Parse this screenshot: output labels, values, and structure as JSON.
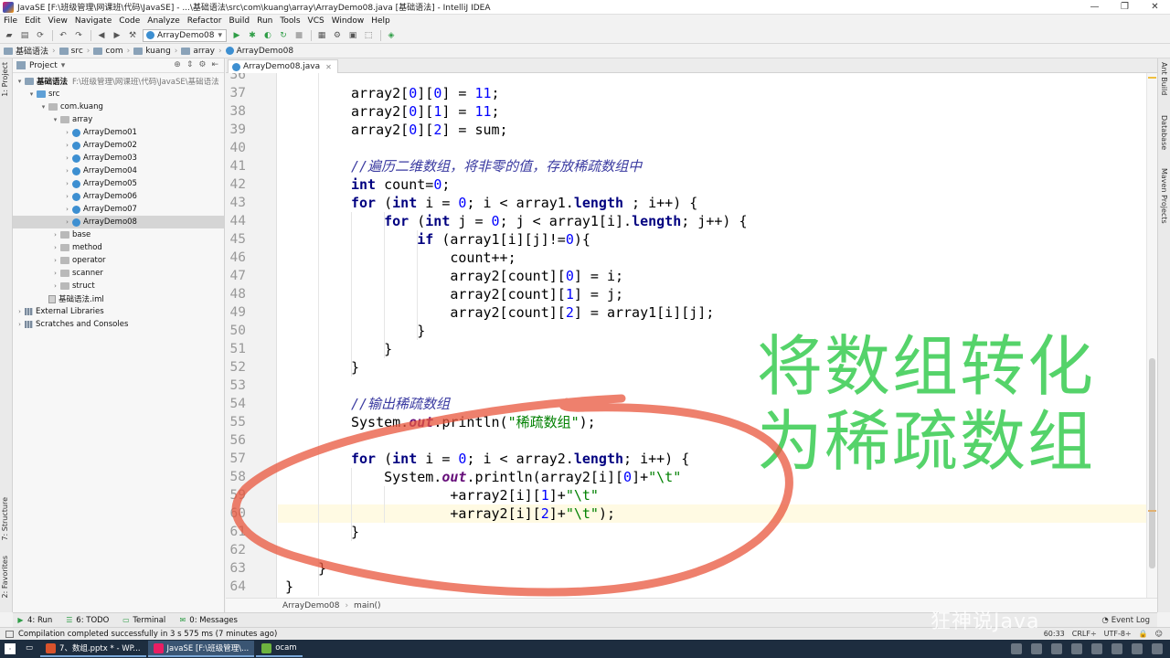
{
  "window": {
    "title": "JavaSE [F:\\班级管理\\网课班\\代码\\JavaSE] - ...\\基础语法\\src\\com\\kuang\\array\\ArrayDemo08.java [基础语法] - IntelliJ IDEA",
    "controls": [
      "—",
      "❐",
      "✕"
    ]
  },
  "menu": [
    "File",
    "Edit",
    "View",
    "Navigate",
    "Code",
    "Analyze",
    "Refactor",
    "Build",
    "Run",
    "Tools",
    "VCS",
    "Window",
    "Help"
  ],
  "toolbar": {
    "run_config": "ArrayDemo08"
  },
  "breadcrumb": [
    "基础语法",
    "src",
    "com",
    "kuang",
    "array",
    "ArrayDemo08"
  ],
  "left_tabs": [
    "1: Project",
    "7: Structure",
    "2: Favorites"
  ],
  "right_tabs": [
    "Ant Build",
    "Database",
    "Maven Projects"
  ],
  "project": {
    "header": "Project",
    "tree": [
      {
        "label": "基础语法",
        "path": "F:\\班级管理\\网课班\\代码\\JavaSE\\基础语法",
        "type": "module"
      },
      {
        "label": "src",
        "type": "src"
      },
      {
        "label": "com.kuang",
        "type": "pkg"
      },
      {
        "label": "array",
        "type": "pkg"
      },
      {
        "label": "ArrayDemo01",
        "type": "class"
      },
      {
        "label": "ArrayDemo02",
        "type": "class"
      },
      {
        "label": "ArrayDemo03",
        "type": "class"
      },
      {
        "label": "ArrayDemo04",
        "type": "class"
      },
      {
        "label": "ArrayDemo05",
        "type": "class"
      },
      {
        "label": "ArrayDemo06",
        "type": "class"
      },
      {
        "label": "ArrayDemo07",
        "type": "class"
      },
      {
        "label": "ArrayDemo08",
        "type": "class"
      },
      {
        "label": "base",
        "type": "pkg"
      },
      {
        "label": "method",
        "type": "pkg"
      },
      {
        "label": "operator",
        "type": "pkg"
      },
      {
        "label": "scanner",
        "type": "pkg"
      },
      {
        "label": "struct",
        "type": "pkg"
      },
      {
        "label": "基础语法.iml",
        "type": "file"
      },
      {
        "label": "External Libraries",
        "type": "lib"
      },
      {
        "label": "Scratches and Consoles",
        "type": "lib"
      }
    ]
  },
  "editor": {
    "tab": "ArrayDemo08.java",
    "line_numbers": [
      "36",
      "37",
      "38",
      "39",
      "40",
      "41",
      "42",
      "43",
      "44",
      "45",
      "46",
      "47",
      "48",
      "49",
      "50",
      "51",
      "52",
      "53",
      "54",
      "55",
      "56",
      "57",
      "58",
      "59",
      "60",
      "61",
      "62",
      "63",
      "64"
    ],
    "code_lines": [
      [],
      [
        {
          "t": "array2[",
          "c": ""
        },
        {
          "t": "0",
          "c": "num"
        },
        {
          "t": "][",
          "c": ""
        },
        {
          "t": "0",
          "c": "num"
        },
        {
          "t": "] = ",
          "c": ""
        },
        {
          "t": "11",
          "c": "num"
        },
        {
          "t": ";",
          "c": ""
        }
      ],
      [
        {
          "t": "array2[",
          "c": ""
        },
        {
          "t": "0",
          "c": "num"
        },
        {
          "t": "][",
          "c": ""
        },
        {
          "t": "1",
          "c": "num"
        },
        {
          "t": "] = ",
          "c": ""
        },
        {
          "t": "11",
          "c": "num"
        },
        {
          "t": ";",
          "c": ""
        }
      ],
      [
        {
          "t": "array2[",
          "c": ""
        },
        {
          "t": "0",
          "c": "num"
        },
        {
          "t": "][",
          "c": ""
        },
        {
          "t": "2",
          "c": "num"
        },
        {
          "t": "] = sum;",
          "c": ""
        }
      ],
      [],
      [
        {
          "t": "//遍历二维数组，将非零的值，存放稀疏数组中",
          "c": "cm"
        }
      ],
      [
        {
          "t": "int",
          "c": "kw"
        },
        {
          "t": " count=",
          "c": ""
        },
        {
          "t": "0",
          "c": "num"
        },
        {
          "t": ";",
          "c": ""
        }
      ],
      [
        {
          "t": "for",
          "c": "kw"
        },
        {
          "t": " (",
          "c": ""
        },
        {
          "t": "int",
          "c": "kw"
        },
        {
          "t": " i = ",
          "c": ""
        },
        {
          "t": "0",
          "c": "num"
        },
        {
          "t": "; i < array1.",
          "c": ""
        },
        {
          "t": "length",
          "c": "kw"
        },
        {
          "t": " ; i++) {",
          "c": ""
        }
      ],
      [
        {
          "t": "    ",
          "c": ""
        },
        {
          "t": "for",
          "c": "kw"
        },
        {
          "t": " (",
          "c": ""
        },
        {
          "t": "int",
          "c": "kw"
        },
        {
          "t": " j = ",
          "c": ""
        },
        {
          "t": "0",
          "c": "num"
        },
        {
          "t": "; j < array1[i].",
          "c": ""
        },
        {
          "t": "length",
          "c": "kw"
        },
        {
          "t": "; j++) {",
          "c": ""
        }
      ],
      [
        {
          "t": "        ",
          "c": ""
        },
        {
          "t": "if",
          "c": "kw"
        },
        {
          "t": " (array1[i][j]!=",
          "c": ""
        },
        {
          "t": "0",
          "c": "num"
        },
        {
          "t": "){",
          "c": ""
        }
      ],
      [
        {
          "t": "            count++;",
          "c": ""
        }
      ],
      [
        {
          "t": "            array2[count][",
          "c": ""
        },
        {
          "t": "0",
          "c": "num"
        },
        {
          "t": "] = i;",
          "c": ""
        }
      ],
      [
        {
          "t": "            array2[count][",
          "c": ""
        },
        {
          "t": "1",
          "c": "num"
        },
        {
          "t": "] = j;",
          "c": ""
        }
      ],
      [
        {
          "t": "            array2[count][",
          "c": ""
        },
        {
          "t": "2",
          "c": "num"
        },
        {
          "t": "] = array1[i][j];",
          "c": ""
        }
      ],
      [
        {
          "t": "        }",
          "c": ""
        }
      ],
      [
        {
          "t": "    }",
          "c": ""
        }
      ],
      [
        {
          "t": "}",
          "c": ""
        }
      ],
      [],
      [
        {
          "t": "//输出稀疏数组",
          "c": "cm"
        }
      ],
      [
        {
          "t": "System.",
          "c": ""
        },
        {
          "t": "out",
          "c": "fld"
        },
        {
          "t": ".println(",
          "c": ""
        },
        {
          "t": "\"稀疏数组\"",
          "c": "st"
        },
        {
          "t": ");",
          "c": ""
        }
      ],
      [],
      [
        {
          "t": "for",
          "c": "kw"
        },
        {
          "t": " (",
          "c": ""
        },
        {
          "t": "int",
          "c": "kw"
        },
        {
          "t": " i = ",
          "c": ""
        },
        {
          "t": "0",
          "c": "num"
        },
        {
          "t": "; i < array2.",
          "c": ""
        },
        {
          "t": "length",
          "c": "kw"
        },
        {
          "t": "; i++) {",
          "c": ""
        }
      ],
      [
        {
          "t": "    System.",
          "c": ""
        },
        {
          "t": "out",
          "c": "fld"
        },
        {
          "t": ".println(array2[i][",
          "c": ""
        },
        {
          "t": "0",
          "c": "num"
        },
        {
          "t": "]+",
          "c": ""
        },
        {
          "t": "\"\\t\"",
          "c": "st"
        }
      ],
      [
        {
          "t": "            +array2[i][",
          "c": ""
        },
        {
          "t": "1",
          "c": "num"
        },
        {
          "t": "]+",
          "c": ""
        },
        {
          "t": "\"\\t\"",
          "c": "st"
        }
      ],
      [
        {
          "t": "            +array2[i][",
          "c": ""
        },
        {
          "t": "2",
          "c": "num"
        },
        {
          "t": "]+",
          "c": ""
        },
        {
          "t": "\"\\t\"",
          "c": "st"
        },
        {
          "t": ");",
          "c": ""
        }
      ],
      [
        {
          "t": "}",
          "c": ""
        }
      ],
      [],
      [
        {
          "t": "}",
          "c": ""
        }
      ],
      [
        {
          "t": "}",
          "c": ""
        }
      ]
    ],
    "code_indent": [
      0,
      1,
      1,
      1,
      0,
      1,
      1,
      1,
      1,
      1,
      1,
      1,
      1,
      1,
      1,
      1,
      1,
      0,
      1,
      1,
      0,
      1,
      1,
      1,
      1,
      1,
      0,
      0,
      -1
    ],
    "breadcrumb": [
      "ArrayDemo08",
      "main()"
    ]
  },
  "overlay": {
    "line1": "将数组转化",
    "line2": "为稀疏数组",
    "color": "#55d36a"
  },
  "annotation_color": "#e8553c",
  "toolwindows": [
    {
      "label": "4: Run",
      "icon": "▶"
    },
    {
      "label": "6: TODO",
      "icon": "☰"
    },
    {
      "label": "Terminal",
      "icon": "▭"
    },
    {
      "label": "0: Messages",
      "icon": "✉"
    }
  ],
  "event_log": "Event Log",
  "status": {
    "message": "Compilation completed successfully in 3 s 575 ms (7 minutes ago)",
    "position": "60:33",
    "line_sep": "CRLF÷",
    "encoding": "UTF-8÷"
  },
  "watermark": "狂神说Java",
  "taskbar": [
    {
      "label": "7、数组.pptx * - WP...",
      "color": "#d9532c"
    },
    {
      "label": "JavaSE [F:\\班级管理\\...",
      "color": "#e91e63"
    },
    {
      "label": "ocam",
      "color": "#6db33f"
    }
  ]
}
